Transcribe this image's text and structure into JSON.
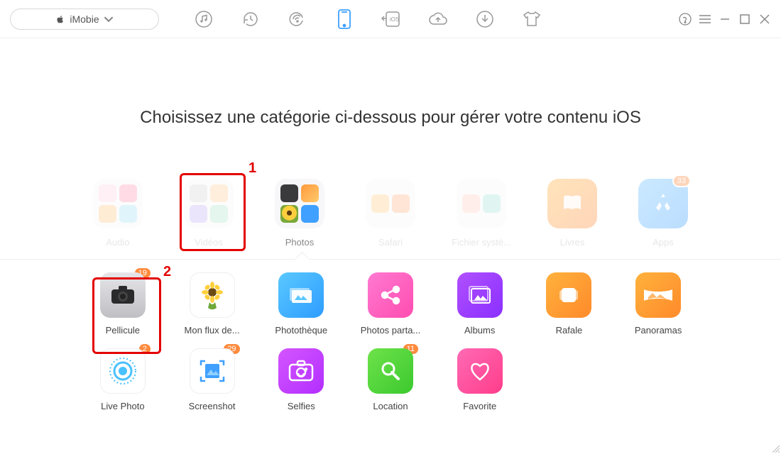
{
  "toolbar": {
    "brand": "iMobie"
  },
  "title": "Choisissez une catégorie ci-dessous pour gérer votre contenu iOS",
  "categories": [
    {
      "label": "Audio",
      "dim": true
    },
    {
      "label": "Vidéos",
      "dim": true
    },
    {
      "label": "Photos",
      "dim": false
    },
    {
      "label": "Safari",
      "dim": true
    },
    {
      "label": "Fichier systè...",
      "dim": true
    },
    {
      "label": "Livres",
      "dim": true,
      "single": true
    },
    {
      "label": "Apps",
      "dim": true,
      "single": true,
      "badge": "33"
    }
  ],
  "callouts": {
    "c1": "1",
    "c2": "2"
  },
  "items_row1": [
    {
      "label": "Pellicule",
      "badge": "19"
    },
    {
      "label": "Mon flux de..."
    },
    {
      "label": "Photothèque"
    },
    {
      "label": "Photos parta..."
    },
    {
      "label": "Albums"
    },
    {
      "label": "Rafale"
    },
    {
      "label": "Panoramas"
    }
  ],
  "items_row2": [
    {
      "label": "Live Photo",
      "badge": "2"
    },
    {
      "label": "Screenshot",
      "badge": "29"
    },
    {
      "label": "Selfies"
    },
    {
      "label": "Location",
      "badge": "11"
    },
    {
      "label": "Favorite"
    }
  ]
}
